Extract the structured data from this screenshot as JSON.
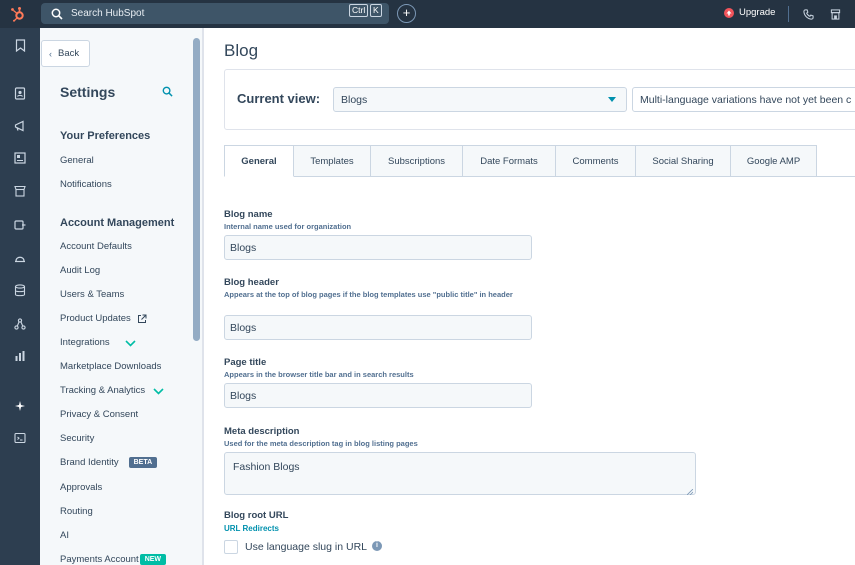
{
  "topbar": {
    "search_placeholder": "Search HubSpot",
    "kbd_ctrl": "Ctrl",
    "kbd_k": "K",
    "plus_label": "+",
    "upgrade_label": "Upgrade"
  },
  "settings_nav": {
    "back_label": "Back",
    "title": "Settings",
    "preferences_heading": "Your Preferences",
    "preferences_items": [
      "General",
      "Notifications"
    ],
    "account_heading": "Account Management",
    "account_items": {
      "account_defaults": "Account Defaults",
      "audit_log": "Audit Log",
      "users_teams": "Users & Teams",
      "product_updates": "Product Updates",
      "integrations": "Integrations",
      "marketplace_downloads": "Marketplace Downloads",
      "tracking_analytics": "Tracking & Analytics",
      "privacy_consent": "Privacy & Consent",
      "security": "Security",
      "brand_identity": "Brand Identity",
      "approvals": "Approvals",
      "routing": "Routing",
      "ai": "AI",
      "payments_account": "Payments Account"
    },
    "badge_beta": "BETA",
    "badge_new": "NEW"
  },
  "main": {
    "page_title": "Blog",
    "current_view_label": "Current view:",
    "current_view_value": "Blogs",
    "language_note": "Multi-language variations have not yet been c",
    "tabs": [
      "General",
      "Templates",
      "Subscriptions",
      "Date Formats",
      "Comments",
      "Social Sharing",
      "Google AMP"
    ],
    "fields": {
      "blog_name_label": "Blog name",
      "blog_name_help": "Internal name used for organization",
      "blog_name_value": "Blogs",
      "blog_header_label": "Blog header",
      "blog_header_help": "Appears at the top of blog pages if the blog templates use \"public title\" in header",
      "blog_header_value": "Blogs",
      "page_title_label": "Page title",
      "page_title_help": "Appears in the browser title bar and in search results",
      "page_title_value": "Blogs",
      "meta_label": "Meta description",
      "meta_help": "Used for the meta description tag in blog listing pages",
      "meta_value": "Fashion Blogs",
      "root_url_label": "Blog root URL",
      "url_redirects_link": "URL Redirects",
      "lang_slug_label": "Use language slug in URL",
      "lang_slug_checked": false
    }
  },
  "colors": {
    "topbar": "#253342",
    "rail": "#2d3e50",
    "accent": "#0091ae",
    "hubspot_orange": "#ff7a59",
    "new_badge": "#00bda5"
  }
}
